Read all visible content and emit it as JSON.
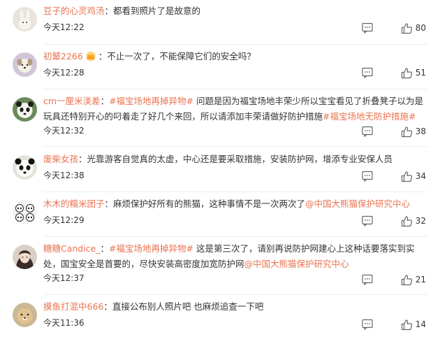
{
  "comments": [
    {
      "user": "豆子的心灵鸡汤",
      "avatar_icon": "bunny-avatar",
      "parts": [
        {
          "kind": "text",
          "value": "：都看到照片了是故意的"
        }
      ],
      "time": "今天12:22",
      "likes": "80"
    },
    {
      "user": "初鼙2266",
      "avatar_icon": "dog-avatar",
      "badge_icon": "crown-badge-icon",
      "parts": [
        {
          "kind": "text",
          "value": "：不止一次了，不能保障它们的安全吗？"
        }
      ],
      "time": "今天12:28",
      "likes": "51"
    },
    {
      "user": "cm一厘米渼差",
      "avatar_icon": "panda-avatar",
      "parts": [
        {
          "kind": "text",
          "value": "："
        },
        {
          "kind": "topic",
          "value": "#福宝场地再掉异物#"
        },
        {
          "kind": "text",
          "value": " 问题是因为福宝场地丰荣少所以宝宝看见了折叠凳子以为是玩具还特别开心的叼着走了好几个来回，所以请添加丰荣请做好防护措施"
        },
        {
          "kind": "topic",
          "value": "#福宝场地无防护措施#"
        }
      ],
      "time": "今天12:32",
      "likes": "38"
    },
    {
      "user": "废柴女孩",
      "avatar_icon": "panda-face-avatar",
      "parts": [
        {
          "kind": "text",
          "value": "：光靠游客自觉真的太虚，中心还是要采取措施，安装防护网，增添专业安保人员"
        }
      ],
      "time": "今天12:38",
      "likes": "34"
    },
    {
      "user": "木木的糯米团子",
      "avatar_icon": "panda-group-avatar",
      "parts": [
        {
          "kind": "text",
          "value": "：麻烦保护好所有的熊猫，这种事情不是一次两次了"
        },
        {
          "kind": "mention",
          "value": "@中国大熊猫保护研究中心"
        }
      ],
      "time": "今天12:29",
      "likes": "32"
    },
    {
      "user": "糖糖Candice_",
      "avatar_icon": "girl-avatar",
      "parts": [
        {
          "kind": "text",
          "value": "："
        },
        {
          "kind": "topic",
          "value": "#福宝场地再掉异物#"
        },
        {
          "kind": "text",
          "value": " 这是第三次了，请别再说防护网建心上这种话要落实到实处，国宝安全是首要的，尽快安装高密度加宽防护网"
        },
        {
          "kind": "mention",
          "value": "@中国大熊猫保护研究中心"
        }
      ],
      "time": "今天12:37",
      "likes": "21"
    },
    {
      "user": "摸鱼打混中666",
      "avatar_icon": "doge-avatar",
      "parts": [
        {
          "kind": "text",
          "value": "：直接公布别人照片吧 也麻烦追查一下吧"
        }
      ],
      "time": "今天11:36",
      "likes": "14"
    }
  ]
}
